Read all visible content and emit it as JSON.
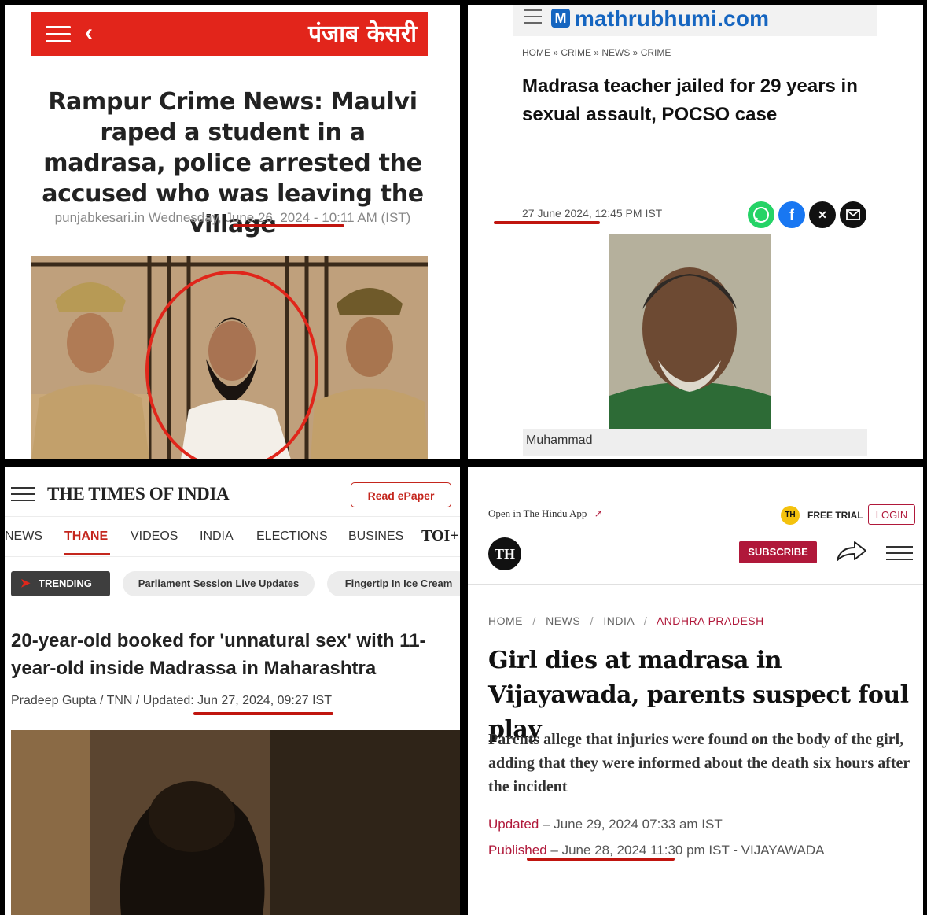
{
  "panel_punjab_kesari": {
    "logo": "पंजाब केसरी",
    "headline": "Rampur Crime News: Maulvi raped a student in a madrasa, police arrested the accused who was leaving the village",
    "meta": "punjabkesari.in Wednesday, June 26, 2024 - 10:11 AM (IST)"
  },
  "panel_mathrubhumi": {
    "logo_letter": "M",
    "logo": "mathrubhumi.com",
    "breadcrumb": "HOME » CRIME » NEWS » CRIME",
    "headline": "Madrasa teacher jailed for 29 years in sexual assault, POCSO case",
    "date": "27 June 2024, 12:45 PM IST",
    "photo_caption": "Muhammad",
    "share_icons": [
      "whatsapp-icon",
      "facebook-icon",
      "x-icon",
      "mail-icon"
    ]
  },
  "panel_times_of_india": {
    "logo": "THE TIMES OF INDIA",
    "epaper_button": "Read ePaper",
    "nav": [
      "NEWS",
      "THANE",
      "VIDEOS",
      "INDIA",
      "ELECTIONS",
      "BUSINES",
      "TOI+"
    ],
    "nav_active": "THANE",
    "trending_label": "TRENDING",
    "trending_pills": [
      "Parliament Session Live Updates",
      "Fingertip In Ice Cream"
    ],
    "headline": "20-year-old booked for 'unnatural sex' with 11-year-old inside Madrassa in Maharashtra",
    "byline": "Pradeep Gupta / TNN / Updated: Jun 27, 2024, 09:27 IST"
  },
  "panel_the_hindu": {
    "open_app": "Open in The Hindu App",
    "badge": "TH",
    "free_trial": "FREE TRIAL",
    "login": "LOGIN",
    "logo": "TH",
    "subscribe": "SUBSCRIBE",
    "breadcrumb": [
      "HOME",
      "NEWS",
      "INDIA",
      "ANDHRA PRADESH"
    ],
    "headline": "Girl dies at madrasa in Vijayawada, parents suspect foul play",
    "standfirst": "Parents allege that injuries were found on the body of the girl, adding that they were informed about the death six hours after the incident",
    "updated_label": "Updated",
    "updated_value": "June 29, 2024 07:33 am IST",
    "published_label": "Published",
    "published_value": "June 28, 2024 11:30 pm IST - VIJAYAWADA"
  },
  "colors": {
    "punjab_kesari_red": "#e2251b",
    "mathrubhumi_blue": "#1565c0",
    "toi_red": "#c4261d",
    "hindu_maroon": "#b0183a",
    "underline_red": "#c0150f"
  }
}
